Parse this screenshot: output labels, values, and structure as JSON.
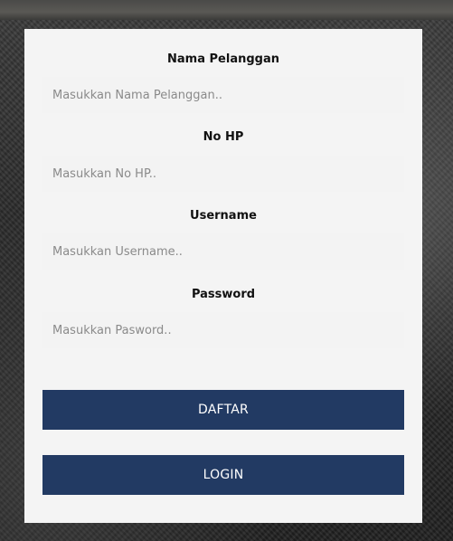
{
  "form": {
    "fields": [
      {
        "label": "Nama Pelanggan",
        "value": "",
        "placeholder": "Masukkan Nama Pelanggan.."
      },
      {
        "label": "No HP",
        "value": "",
        "placeholder": "Masukkan No HP.."
      },
      {
        "label": "Username",
        "value": "",
        "placeholder": "Masukkan Username.."
      },
      {
        "label": "Password",
        "value": "",
        "placeholder": "Masukkan Pasword.."
      }
    ],
    "buttons": {
      "register_label": "DAFTAR",
      "login_label": "LOGIN"
    }
  },
  "colors": {
    "card_background": "#f4f4f4",
    "input_background": "#f3f3f3",
    "button_background": "#223a63",
    "button_text": "#ffffff",
    "label_text": "#111111",
    "placeholder_text": "#8a8a8a"
  }
}
